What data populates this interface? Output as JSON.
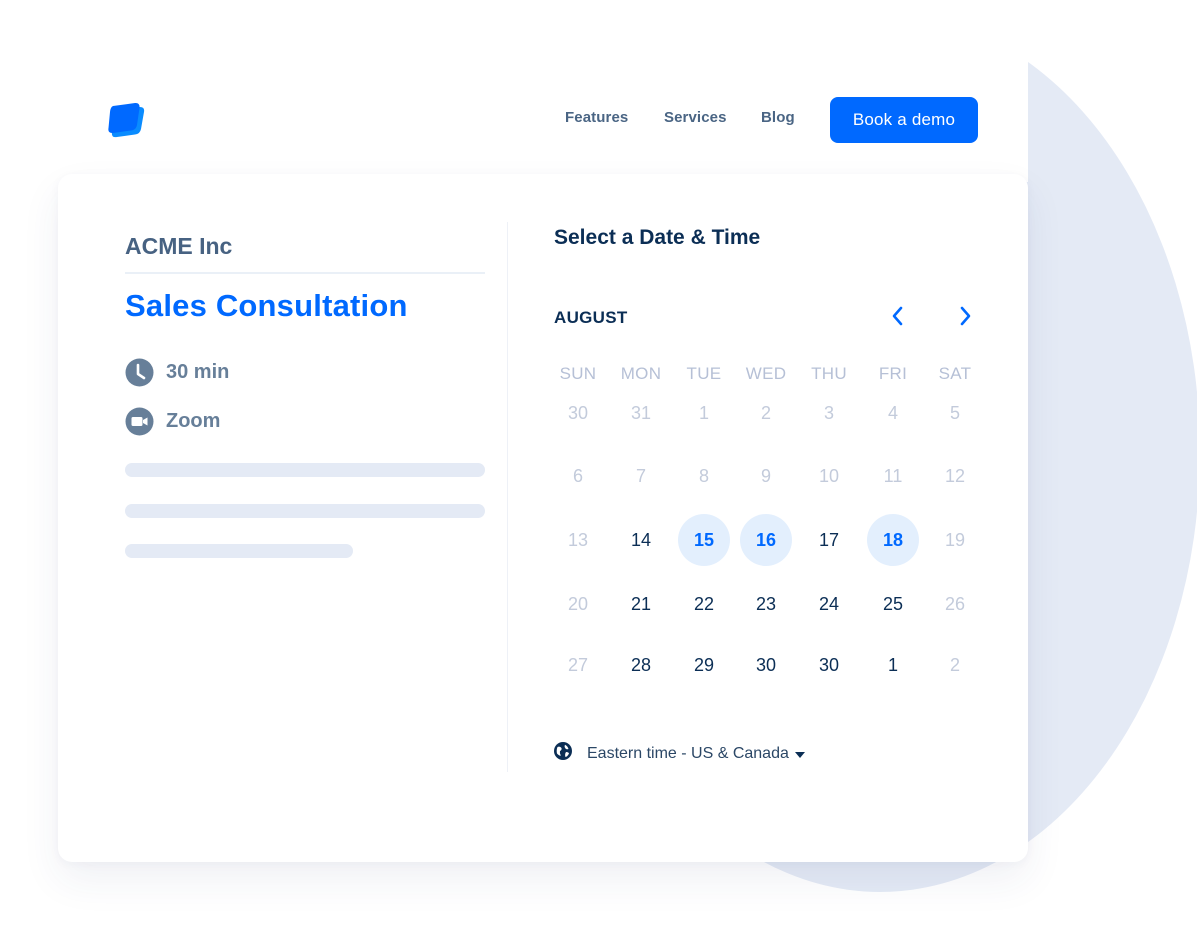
{
  "header": {
    "logo": "layers-logo-icon",
    "nav": [
      {
        "label": "Features"
      },
      {
        "label": "Services"
      },
      {
        "label": "Blog"
      }
    ],
    "cta_label": "Book a demo"
  },
  "event": {
    "company": "ACME Inc",
    "title": "Sales Consultation",
    "duration": {
      "icon": "clock-icon",
      "label": "30 min"
    },
    "location": {
      "icon": "video-camera-icon",
      "label": "Zoom"
    }
  },
  "scheduler": {
    "title": "Select a Date & Time",
    "month": "AUGUST",
    "prev_icon": "chevron-left-icon",
    "next_icon": "chevron-right-icon",
    "weekdays": [
      "SUN",
      "MON",
      "TUE",
      "WED",
      "THU",
      "FRI",
      "SAT"
    ],
    "weeks": [
      [
        {
          "d": "30",
          "s": "off"
        },
        {
          "d": "31",
          "s": "off"
        },
        {
          "d": "1",
          "s": "off"
        },
        {
          "d": "2",
          "s": "off"
        },
        {
          "d": "3",
          "s": "off"
        },
        {
          "d": "4",
          "s": "off"
        },
        {
          "d": "5",
          "s": "off"
        }
      ],
      [
        {
          "d": "6",
          "s": "off"
        },
        {
          "d": "7",
          "s": "off"
        },
        {
          "d": "8",
          "s": "off"
        },
        {
          "d": "9",
          "s": "off"
        },
        {
          "d": "10",
          "s": "off"
        },
        {
          "d": "11",
          "s": "off"
        },
        {
          "d": "12",
          "s": "off"
        }
      ],
      [
        {
          "d": "13",
          "s": "off"
        },
        {
          "d": "14",
          "s": "avail"
        },
        {
          "d": "15",
          "s": "highlight"
        },
        {
          "d": "16",
          "s": "highlight"
        },
        {
          "d": "17",
          "s": "avail"
        },
        {
          "d": "18",
          "s": "highlight"
        },
        {
          "d": "19",
          "s": "off"
        }
      ],
      [
        {
          "d": "20",
          "s": "off"
        },
        {
          "d": "21",
          "s": "avail"
        },
        {
          "d": "22",
          "s": "avail"
        },
        {
          "d": "23",
          "s": "avail"
        },
        {
          "d": "24",
          "s": "avail"
        },
        {
          "d": "25",
          "s": "avail"
        },
        {
          "d": "26",
          "s": "off"
        }
      ],
      [
        {
          "d": "27",
          "s": "off"
        },
        {
          "d": "28",
          "s": "avail"
        },
        {
          "d": "29",
          "s": "avail"
        },
        {
          "d": "30",
          "s": "avail"
        },
        {
          "d": "30",
          "s": "avail"
        },
        {
          "d": "1",
          "s": "avail"
        },
        {
          "d": "2",
          "s": "off"
        }
      ]
    ],
    "timezone": {
      "icon": "globe-icon",
      "label": "Eastern time - US & Canada"
    }
  },
  "colors": {
    "brand": "#0069ff",
    "heading": "#0b2e55",
    "muted": "#677f99",
    "disabled_day": "#c3cbdb",
    "highlight_bg": "#e3effd",
    "skeleton": "#e4eaf5"
  }
}
